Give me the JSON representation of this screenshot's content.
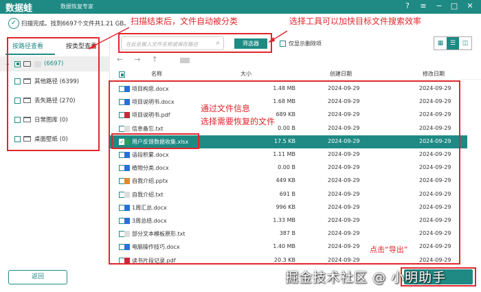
{
  "app": {
    "logo": "数据蛙",
    "subtitle": "数据恢复专家",
    "window_controls": [
      "help-icon",
      "menu-icon",
      "minimize-icon",
      "maximize-icon",
      "close-icon"
    ]
  },
  "status": "扫描完成。找到6697个文件共1.21 GB。",
  "left": {
    "tabs": [
      "按路径查看",
      "按类型查看"
    ],
    "root_count": "(6697)",
    "tree": [
      {
        "label": "其他路径 (6399)",
        "expandable": true
      },
      {
        "label": "丢失路径 (270)",
        "expandable": true
      },
      {
        "label": "日常图库 (0)",
        "expandable": false
      },
      {
        "label": "桌面壁纸 (0)",
        "expandable": false
      }
    ],
    "back": "返回"
  },
  "toolbar": {
    "search_placeholder": "在此处输入文件名称或保存路径",
    "filter": "筛选器",
    "deleted_only": "仅显示删除项"
  },
  "table": {
    "headers": [
      "名称",
      "大小",
      "创建日期",
      "修改日期"
    ],
    "rows": [
      {
        "name": "项目构思.docx",
        "size": "1.48 MB",
        "created": "2024-09-29",
        "modified": "2024-09-29",
        "type": "docx",
        "checked": false
      },
      {
        "name": "项目说明书.docx",
        "size": "1.68 MB",
        "created": "2024-09-29",
        "modified": "2024-09-29",
        "type": "docx",
        "checked": false
      },
      {
        "name": "项目说明书.pdf",
        "size": "689 KB",
        "created": "2024-09-29",
        "modified": "2024-09-29",
        "type": "pdf",
        "checked": false
      },
      {
        "name": "信息备忘.txt",
        "size": "0.00  B",
        "created": "2024-09-29",
        "modified": "2024-09-29",
        "type": "txt",
        "checked": false
      },
      {
        "name": "用户反馈数据收集.xlsx",
        "size": "17.5 KB",
        "created": "2024-09-29",
        "modified": "2024-09-29",
        "type": "xlsx",
        "checked": true
      },
      {
        "name": "语段积累.docx",
        "size": "1.11 MB",
        "created": "2024-09-29",
        "modified": "2024-09-29",
        "type": "docx",
        "checked": false
      },
      {
        "name": "植物分类.docx",
        "size": "0.00  B",
        "created": "2024-09-29",
        "modified": "2024-09-29",
        "type": "docx",
        "checked": false
      },
      {
        "name": "自我介绍.pptx",
        "size": "449 KB",
        "created": "2024-09-29",
        "modified": "2024-09-29",
        "type": "pptx",
        "checked": false
      },
      {
        "name": "自我介绍.txt",
        "size": "691  B",
        "created": "2024-09-29",
        "modified": "2024-09-29",
        "type": "txt",
        "checked": false
      },
      {
        "name": "1周汇总.docx",
        "size": "996 KB",
        "created": "2024-09-29",
        "modified": "2024-09-29",
        "type": "docx",
        "checked": false
      },
      {
        "name": "3周总结.docx",
        "size": "1.33 MB",
        "created": "2024-09-29",
        "modified": "2024-09-29",
        "type": "docx",
        "checked": false
      },
      {
        "name": "部分文本模板原形.txt",
        "size": "387  B",
        "created": "2024-09-29",
        "modified": "2024-09-29",
        "type": "txt",
        "checked": false
      },
      {
        "name": "电脑操作技巧.docx",
        "size": "1.40 MB",
        "created": "2024-09-29",
        "modified": "2024-09-29",
        "type": "docx",
        "checked": false
      },
      {
        "name": "读书片段记录.pdf",
        "size": "20.3 KB",
        "created": "2024-09-29",
        "modified": "2024-09-29",
        "type": "pdf",
        "checked": false
      }
    ]
  },
  "annotations": {
    "a1": "扫描结束后，文件自动被分类",
    "a2": "选择工具可以加快目标文件搜索效率",
    "a3": "通过文件信息",
    "a4": "选择需要恢复的文件",
    "a5": "点击“导出”"
  },
  "watermark": "掘金技术社区 @ 小明助手",
  "colors": {
    "accent": "#1f8a84",
    "annotation": "#e0262b",
    "docx": "#2b6fd6",
    "pdf": "#c8283a",
    "pptx": "#e08a2a",
    "txt": "#dddddd",
    "xlsx": "#2a9d5a"
  }
}
